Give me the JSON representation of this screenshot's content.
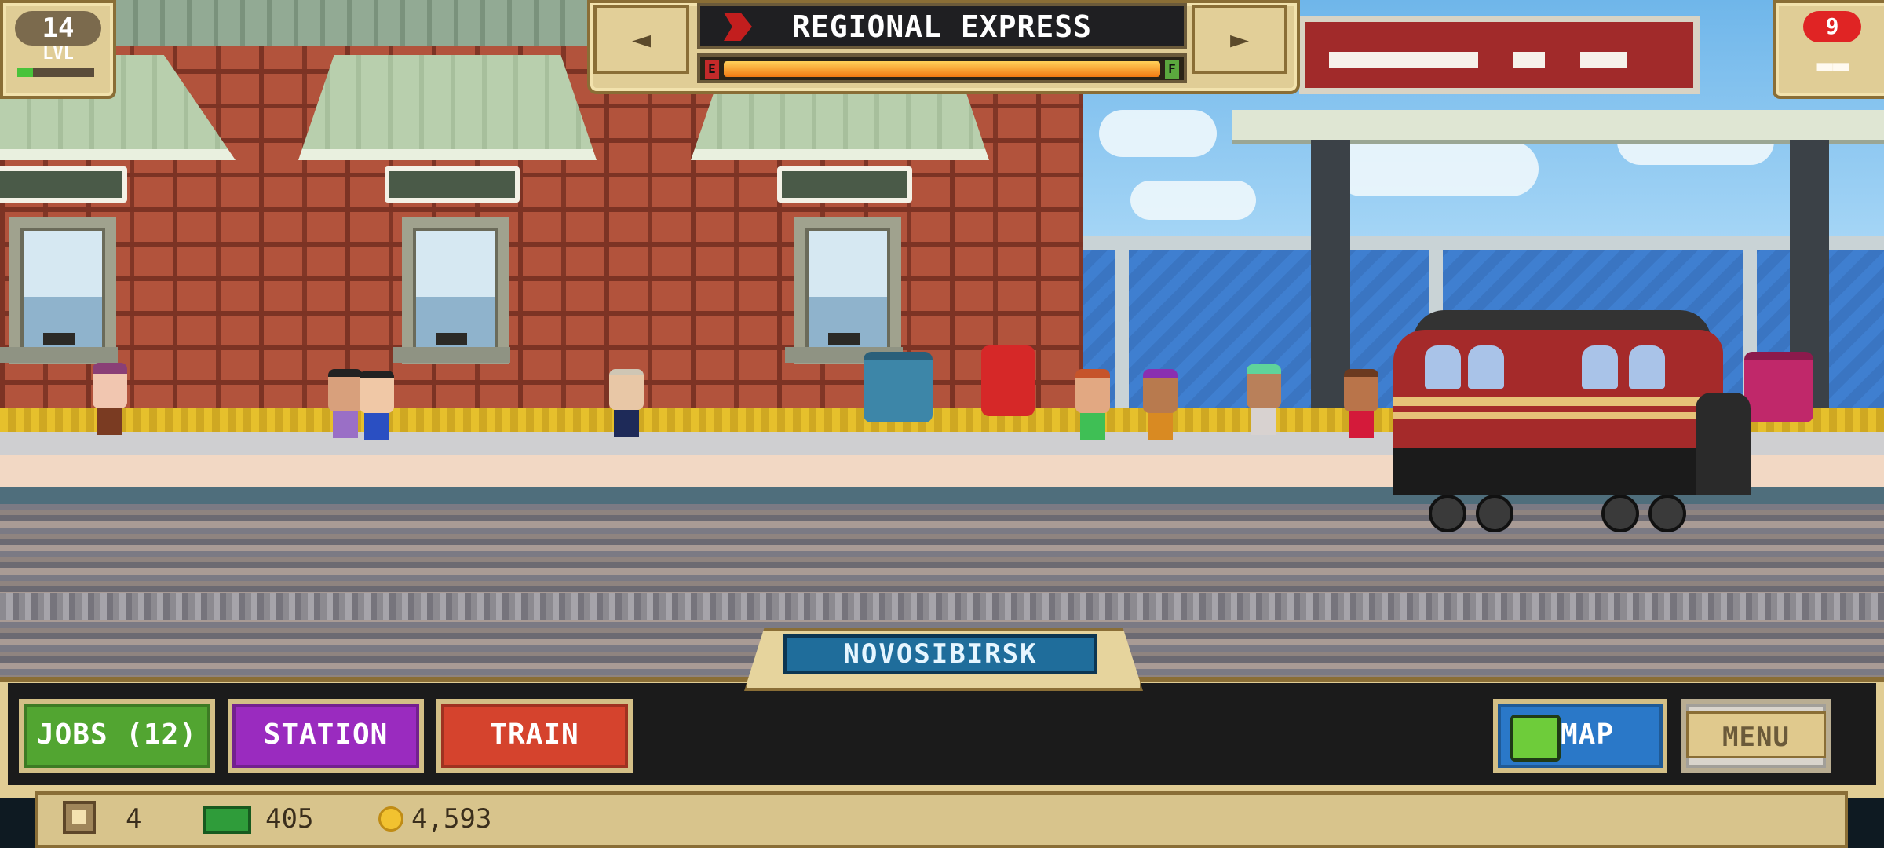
{
  "level": {
    "number": "14",
    "label": "LVL",
    "progress_pct": 20
  },
  "train_selector": {
    "prev_label": "◄",
    "next_label": "►",
    "train_name": "REGIONAL EXPRESS",
    "fuel_empty_label": "E",
    "fuel_full_label": "F",
    "fuel_pct": 100
  },
  "cars": {
    "count": "9"
  },
  "station": {
    "name": "NOVOSIBIRSK"
  },
  "buttons": {
    "jobs": "JOBS (12)",
    "station": "STATION",
    "train": "TRAIN",
    "map": "MAP",
    "menu": "MENU"
  },
  "resources": {
    "crates": "4",
    "cash": "405",
    "coins": "4,593"
  },
  "colors": {
    "jobs_button": "#52a531",
    "station_button": "#9a2bbf",
    "train_button": "#d5432d",
    "map_button": "#2a78c8"
  },
  "icons": {
    "crate": "crate-icon",
    "cash": "cash-icon",
    "coin": "coin-icon",
    "map": "map-icon",
    "train_cars": "train-cars-icon"
  }
}
